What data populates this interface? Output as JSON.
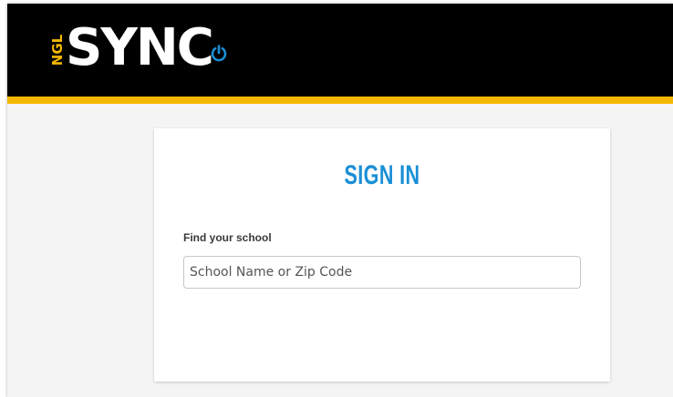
{
  "header": {
    "logo_ngl": "NGL",
    "logo_sync": "SYNC",
    "logo_icon": "power-icon",
    "stripe_color": "#f5b800",
    "background_color": "#000000"
  },
  "signin": {
    "title": "SIGN IN",
    "title_color": "#1a8fd6",
    "field_label": "Find your school",
    "input_placeholder": "School Name or Zip Code",
    "input_value": ""
  }
}
